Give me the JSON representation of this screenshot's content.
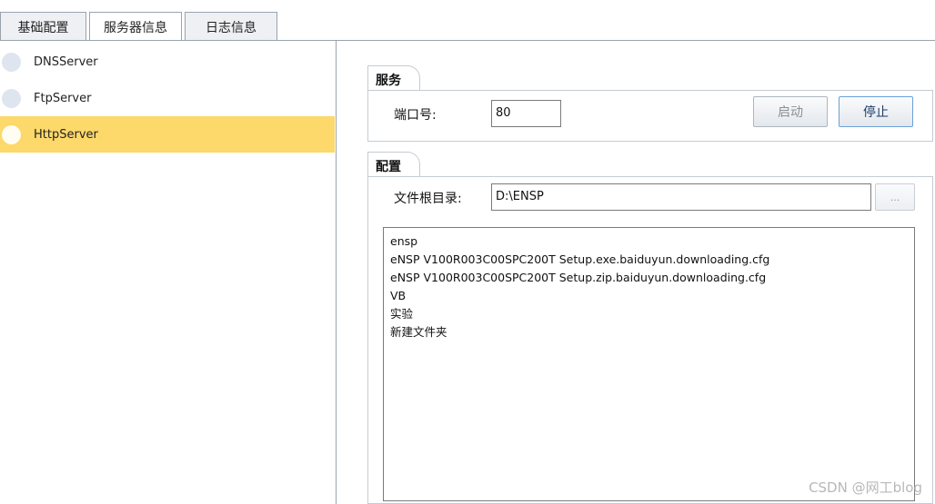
{
  "tabs": [
    {
      "label": "基础配置",
      "active": false
    },
    {
      "label": "服务器信息",
      "active": true
    },
    {
      "label": "日志信息",
      "active": false
    }
  ],
  "servers": [
    {
      "label": "DNSServer",
      "selected": false
    },
    {
      "label": "FtpServer",
      "selected": false
    },
    {
      "label": "HttpServer",
      "selected": true
    }
  ],
  "service": {
    "group_title": "服务",
    "port_label": "端口号:",
    "port_value": "80",
    "start_label": "启动",
    "stop_label": "停止"
  },
  "config": {
    "group_title": "配置",
    "root_label": "文件根目录:",
    "root_value": "D:\\ENSP",
    "browse_label": "...",
    "files": [
      "ensp",
      "eNSP V100R003C00SPC200T Setup.exe.baiduyun.downloading.cfg",
      "eNSP V100R003C00SPC200T Setup.zip.baiduyun.downloading.cfg",
      "VB",
      "实验",
      "新建文件夹"
    ]
  },
  "watermark": "CSDN @网工blog",
  "colors": {
    "selected_row": "#fdd86a",
    "border": "#9aa3ad"
  }
}
